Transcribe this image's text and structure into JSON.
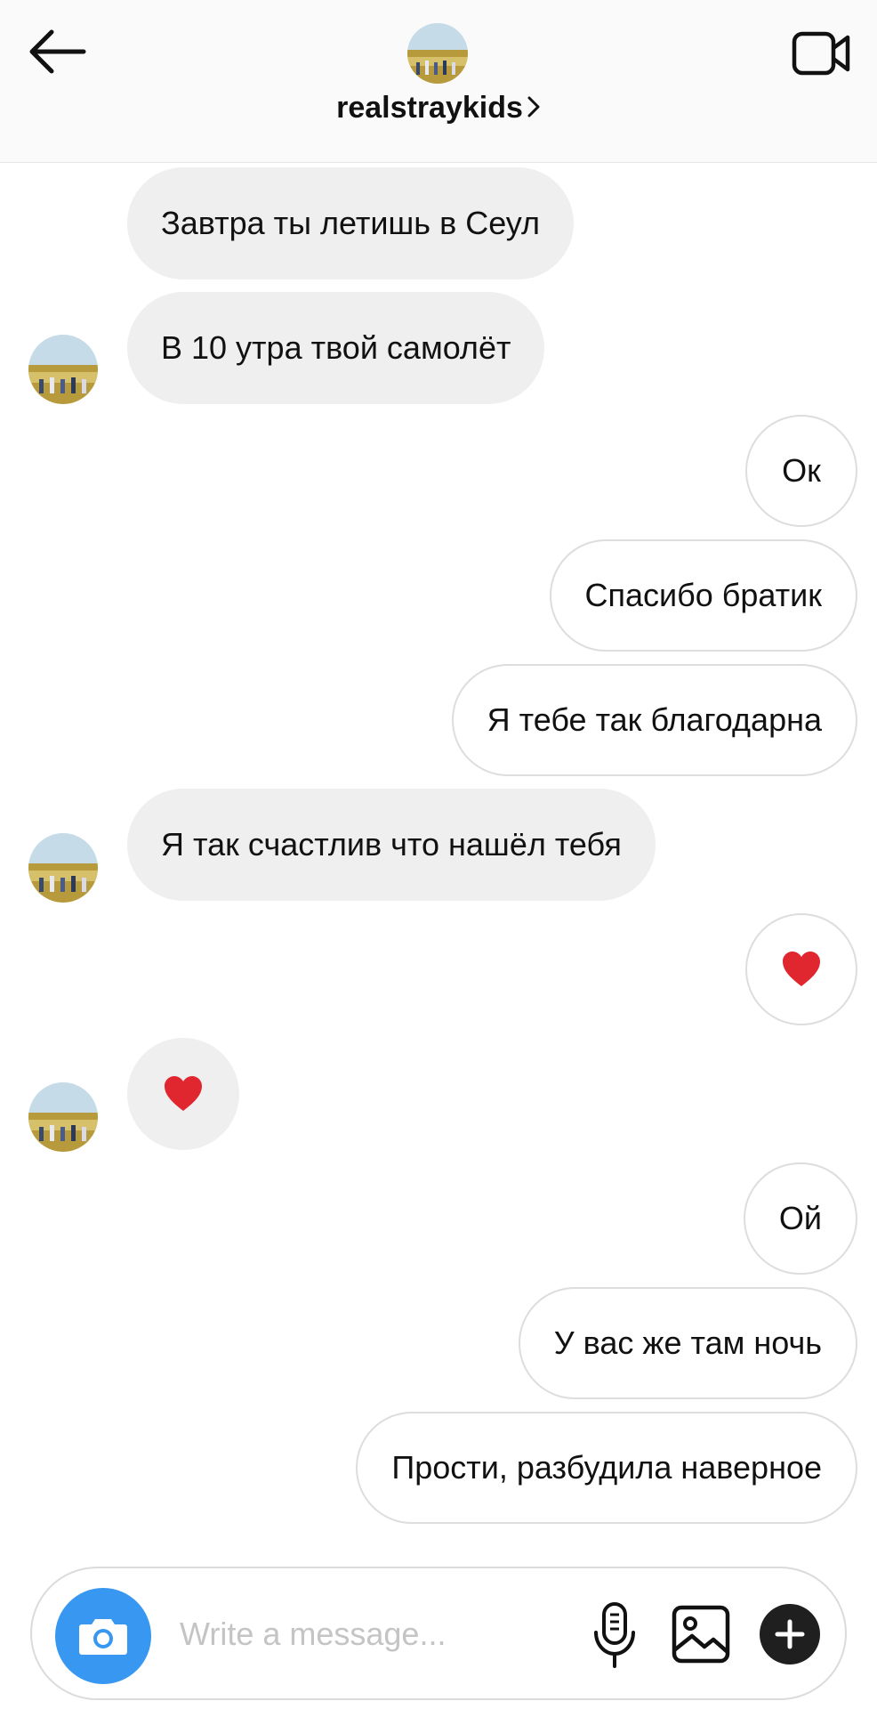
{
  "header": {
    "username": "realstraykids",
    "back_icon": "arrow-left-icon",
    "video_icon": "video-camera-icon"
  },
  "messages": [
    {
      "dir": "in",
      "text": "Завтра ты летишь в Сеул"
    },
    {
      "dir": "in",
      "text": "В 10 утра твой самолёт"
    },
    {
      "dir": "out",
      "text": "Ок"
    },
    {
      "dir": "out",
      "text": "Спасибо братик"
    },
    {
      "dir": "out",
      "text": "Я тебе так благодарна"
    },
    {
      "dir": "in",
      "text": "Я так счастлив что нашёл тебя"
    },
    {
      "dir": "out",
      "emoji": "heart"
    },
    {
      "dir": "in",
      "emoji": "heart"
    },
    {
      "dir": "out",
      "text": "Ой"
    },
    {
      "dir": "out",
      "text": "У вас же там ночь"
    },
    {
      "dir": "out",
      "text": "Прости, разбудила наверное"
    }
  ],
  "composer": {
    "placeholder": "Write a message...",
    "value": ""
  },
  "colors": {
    "incoming_bubble": "#efeff0",
    "outgoing_border": "#dddddd",
    "camera_button": "#3897f0",
    "heart": "#e0262f"
  }
}
